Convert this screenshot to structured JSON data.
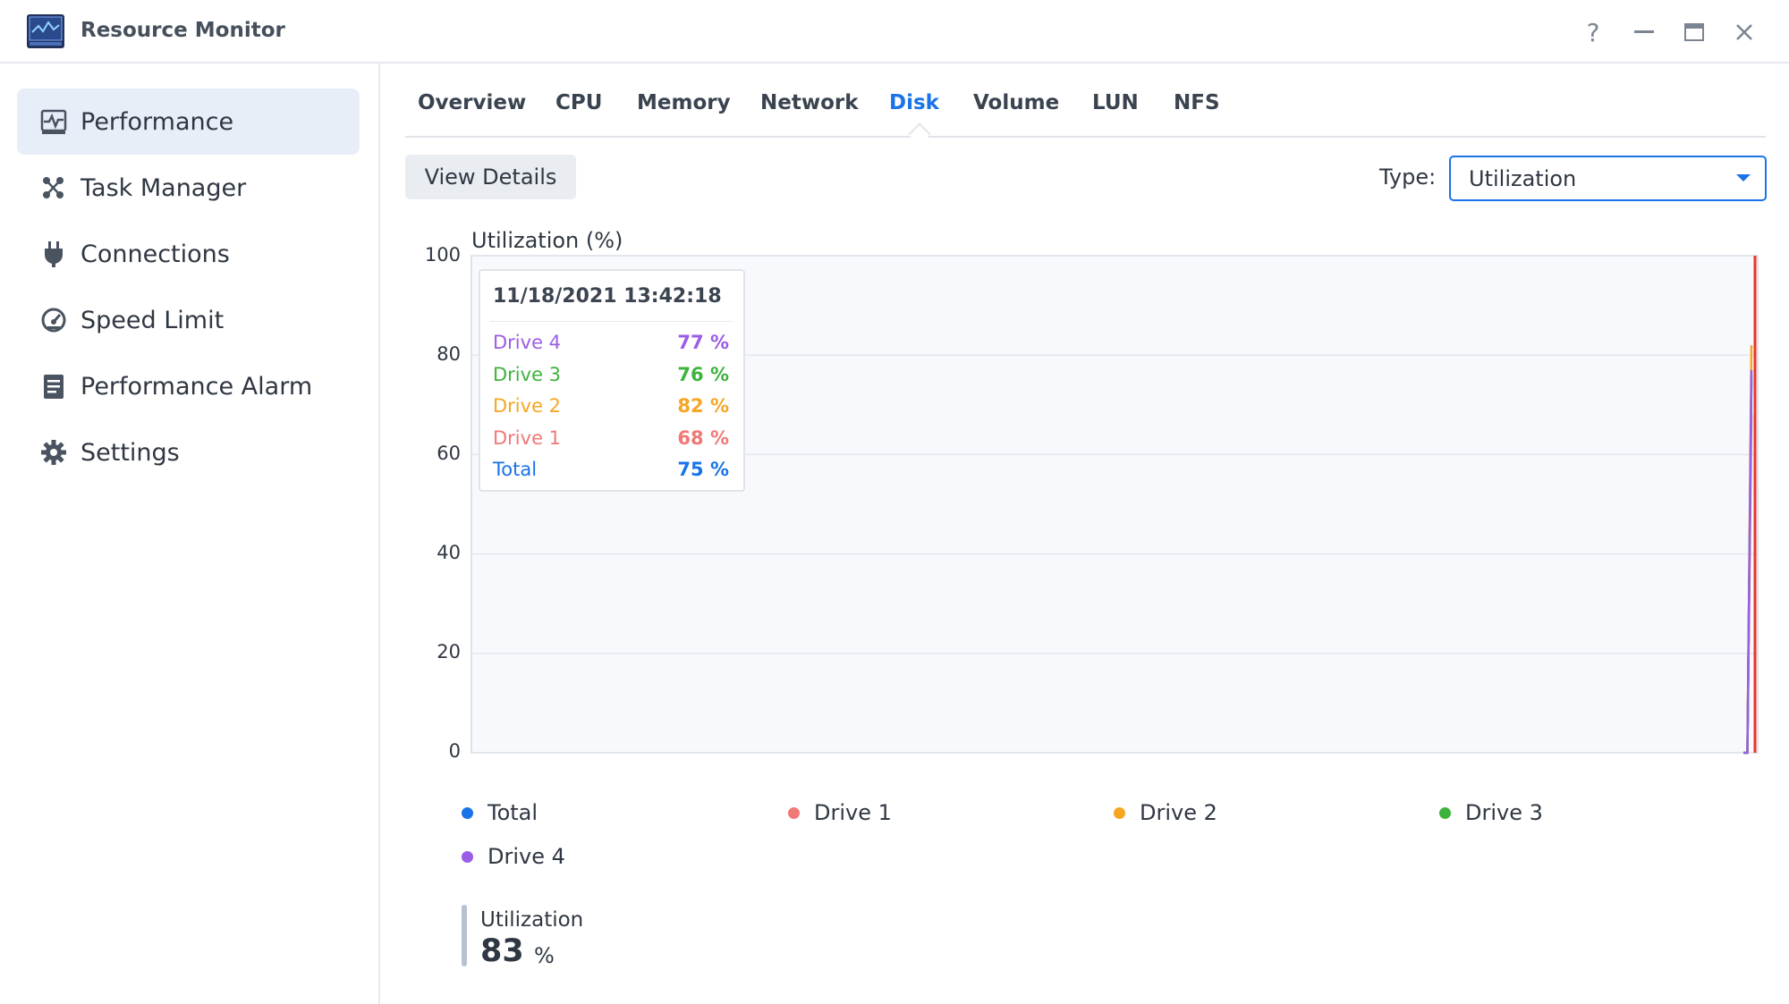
{
  "window": {
    "title": "Resource Monitor",
    "controls": [
      "?",
      "—",
      "▭",
      "✕"
    ]
  },
  "sidebar": {
    "items": [
      {
        "label": "Performance",
        "icon": "performance-chart-icon",
        "active": true
      },
      {
        "label": "Task Manager",
        "icon": "task-manager-icon",
        "active": false
      },
      {
        "label": "Connections",
        "icon": "plug-icon",
        "active": false
      },
      {
        "label": "Speed Limit",
        "icon": "speedometer-icon",
        "active": false
      },
      {
        "label": "Performance Alarm",
        "icon": "clipboard-alarm-icon",
        "active": false
      },
      {
        "label": "Settings",
        "icon": "gear-icon",
        "active": false
      }
    ]
  },
  "tabs": [
    {
      "label": "Overview",
      "active": false
    },
    {
      "label": "CPU",
      "active": false
    },
    {
      "label": "Memory",
      "active": false
    },
    {
      "label": "Network",
      "active": false
    },
    {
      "label": "Disk",
      "active": true
    },
    {
      "label": "Volume",
      "active": false
    },
    {
      "label": "LUN",
      "active": false
    },
    {
      "label": "NFS",
      "active": false
    }
  ],
  "toolbar": {
    "view_details_label": "View Details",
    "type_label": "Type:",
    "type_value": "Utilization"
  },
  "colors": {
    "accent": "#1a73e8",
    "total": "#1a73e8",
    "drive1": "#f07877",
    "drive2": "#f5a623",
    "drive3": "#3db33d",
    "drive4": "#9b5de5",
    "marker": "#e8352b"
  },
  "tooltip": {
    "timestamp": "11/18/2021 13:42:18",
    "rows": [
      {
        "name": "Drive 4",
        "value": "77 %"
      },
      {
        "name": "Drive 3",
        "value": "76 %"
      },
      {
        "name": "Drive 2",
        "value": "82 %"
      },
      {
        "name": "Drive 1",
        "value": "68 %"
      },
      {
        "name": "Total",
        "value": "75 %"
      }
    ]
  },
  "chart_data": {
    "type": "line",
    "ylabel": "Utilization (%)",
    "ylim": [
      0,
      100
    ],
    "yticks": [
      "100",
      "80",
      "60",
      "40",
      "20",
      "0"
    ],
    "grid": true,
    "legend_placement": "bottom",
    "series": [
      {
        "name": "Total",
        "values": [
          0,
          0,
          75
        ]
      },
      {
        "name": "Drive 1",
        "values": [
          0,
          0,
          68
        ]
      },
      {
        "name": "Drive 2",
        "values": [
          0,
          0,
          82
        ]
      },
      {
        "name": "Drive 3",
        "values": [
          0,
          0,
          76
        ]
      },
      {
        "name": "Drive 4",
        "values": [
          0,
          0,
          77
        ]
      }
    ],
    "x": [
      "",
      "",
      "11/18/2021 13:42:18"
    ]
  },
  "legend": [
    {
      "name": "Total"
    },
    {
      "name": "Drive 1"
    },
    {
      "name": "Drive 2"
    },
    {
      "name": "Drive 3"
    },
    {
      "name": "Drive 4"
    }
  ],
  "summary": {
    "label": "Utilization",
    "value": "83",
    "unit": "%"
  }
}
